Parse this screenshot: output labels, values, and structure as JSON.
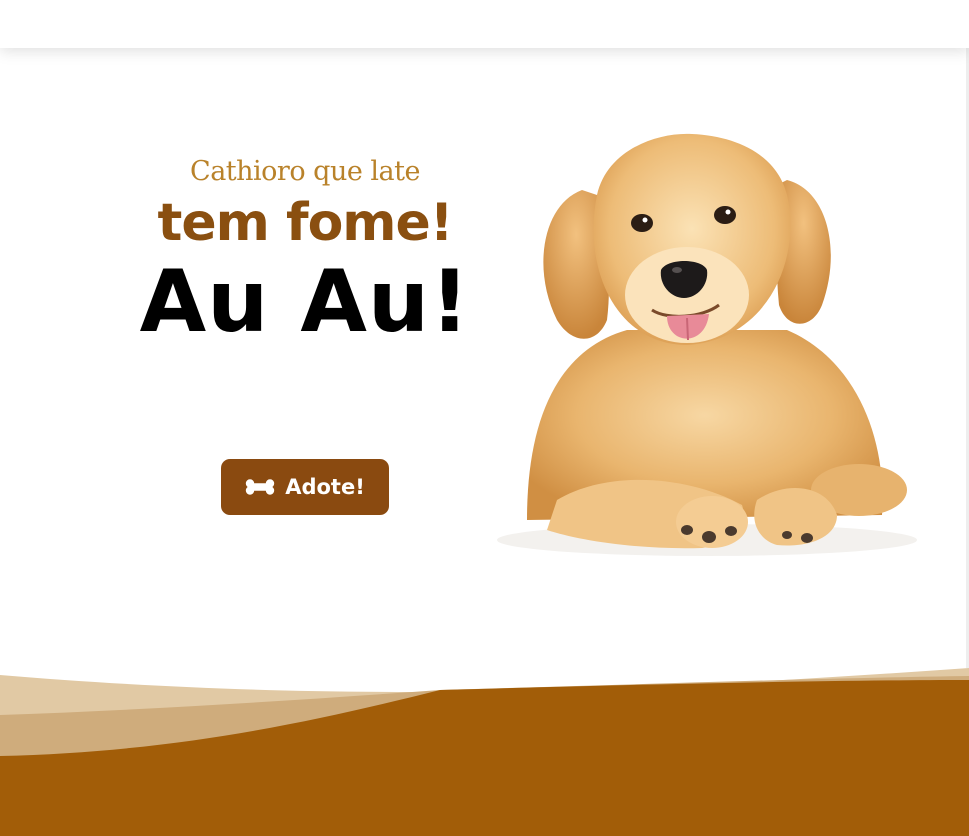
{
  "hero": {
    "subtitle": "Cathioro que late",
    "headline": "tem fome!",
    "bark": "Au Au!",
    "cta_label": "Adote!",
    "cta_icon": "bone-icon"
  },
  "image": {
    "subject": "golden-retriever-puppy"
  },
  "colors": {
    "accent_brown": "#8a4a10",
    "subtitle_gold": "#b9822a",
    "wave_dark": "#a25d08",
    "wave_mid": "#cfac7c",
    "wave_light": "#e1c9a4"
  }
}
